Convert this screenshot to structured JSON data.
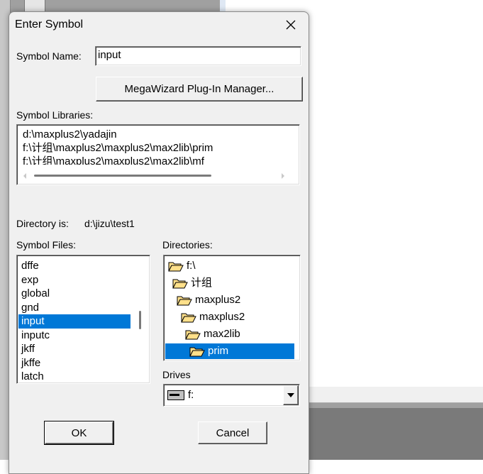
{
  "dialog": {
    "title": "Enter Symbol",
    "symbol_name_label": "Symbol Name:",
    "symbol_name_value": "input",
    "megawizard_label": "MegaWizard Plug-In Manager...",
    "symbol_libraries_label": "Symbol Libraries:",
    "libraries": [
      "d:\\maxplus2\\yadajin",
      "f:\\计组\\maxplus2\\maxplus2\\max2lib\\prim",
      "f:\\计组\\maxplus2\\maxplus2\\max2lib\\mf"
    ],
    "directory_is_label": "Directory is:",
    "directory_is_value": "d:\\jizu\\test1",
    "symbol_files_label": "Symbol Files:",
    "symbol_files": [
      "dffe",
      "exp",
      "global",
      "gnd",
      "input",
      "inputc",
      "jkff",
      "jkffe",
      "latch"
    ],
    "selected_file": "input",
    "directories_label": "Directories:",
    "directories": [
      "f:\\",
      "计组",
      "maxplus2",
      "maxplus2",
      "max2lib",
      "prim"
    ],
    "selected_directory": "prim",
    "drives_label": "Drives",
    "drive_value": "f:",
    "ok_label": "OK",
    "cancel_label": "Cancel"
  },
  "colors": {
    "selection": "#0078d7",
    "dialog_bg": "#f0f0f0",
    "folder": "#ffe08a"
  }
}
